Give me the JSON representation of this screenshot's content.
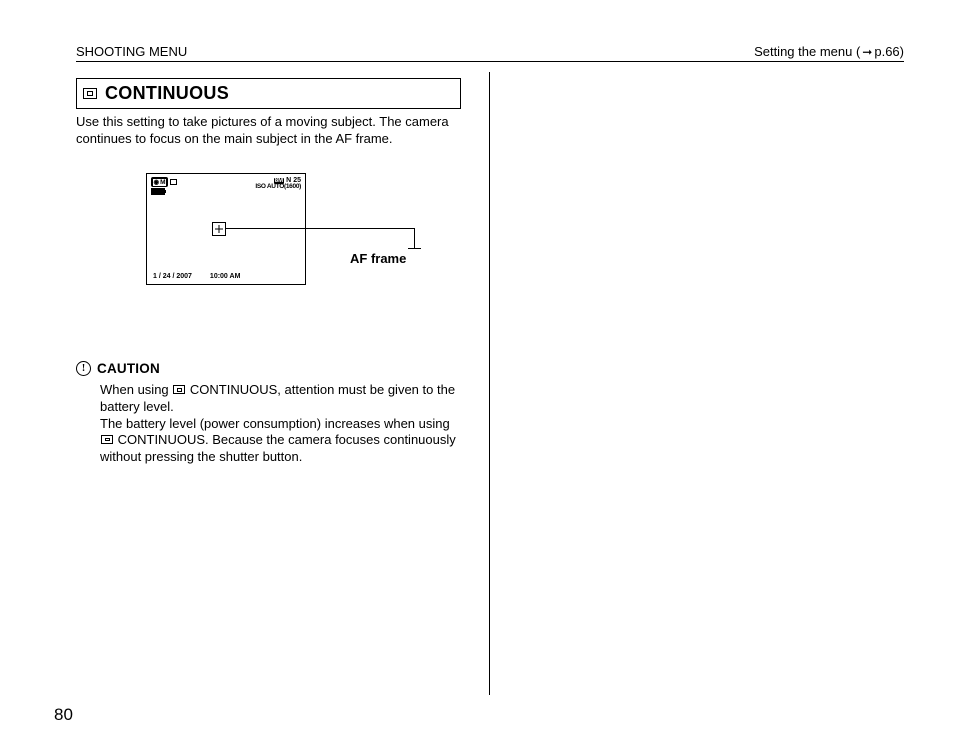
{
  "header": {
    "left": "SHOOTING MENU",
    "right_prefix": "Setting the menu (",
    "right_page": "p.66)",
    "arrow": "➞"
  },
  "section": {
    "title": "CONTINUOUS",
    "para": "Use this setting to take pictures of a moving subject. The camera continues to focus on the main subject in the AF frame."
  },
  "lcd": {
    "mode_m": "M",
    "res_badge": "8M",
    "n": "N",
    "count": "25",
    "iso": "ISO AUTO(1600)",
    "date": "1 / 24 / 2007",
    "time": "10:00 AM"
  },
  "callout": {
    "af_frame": "AF frame"
  },
  "caution": {
    "icon": "!",
    "title": "CAUTION",
    "line1a": "When using ",
    "line1b": " CONTINUOUS, attention must be given to the battery level.",
    "line2a": "The battery level (power consumption) increases when using ",
    "line2b": " CONTINUOUS. Because the camera focuses continuously without pressing the shutter button."
  },
  "page_number": "80"
}
